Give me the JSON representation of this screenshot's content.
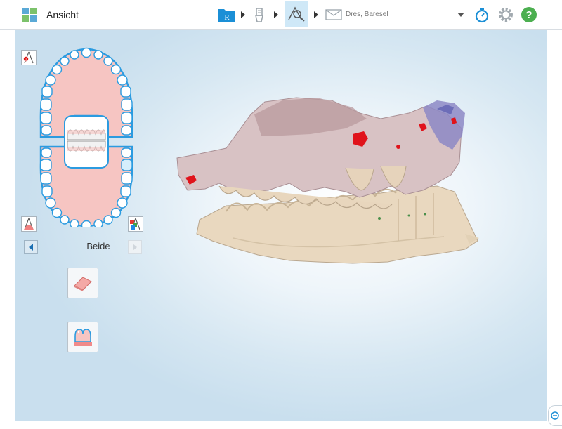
{
  "app": {
    "title": "Ansicht",
    "icon": "app-grid-icon"
  },
  "workflow": {
    "steps": [
      {
        "name": "rx-step",
        "icon": "rx-icon",
        "label": "R"
      },
      {
        "name": "scan-step",
        "icon": "scan-icon"
      },
      {
        "name": "view-step",
        "icon": "view-tools-icon",
        "active": true
      },
      {
        "name": "send-step",
        "icon": "envelope-icon"
      }
    ],
    "patient": "Dres, Baresel"
  },
  "toolbar": {
    "icons": [
      "dropdown-icon",
      "timer-icon",
      "gear-icon",
      "help-icon"
    ]
  },
  "colors": {
    "accent": "#1b8fd6",
    "help": "#4caf50",
    "gum": "#f6c5c2",
    "tooth_outline": "#2b9be0"
  },
  "left_panel": {
    "jaw_selection": "Beide",
    "tools": [
      "occlusion-tool-icon",
      "upper-tool-icon",
      "lower-color-tool-icon",
      "eraser-icon",
      "margin-line-icon"
    ]
  }
}
